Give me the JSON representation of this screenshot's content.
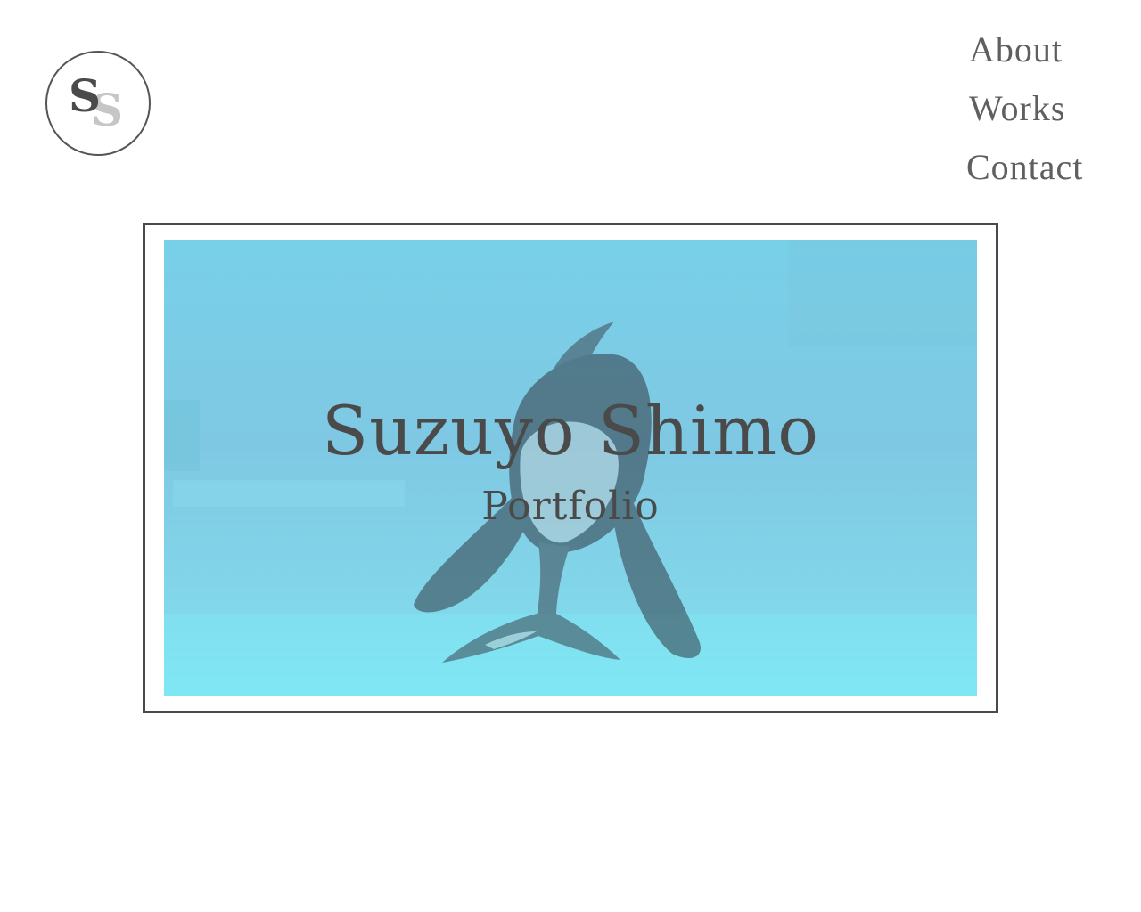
{
  "logo": {
    "letter_primary": "S",
    "letter_secondary": "S"
  },
  "nav": {
    "items": [
      {
        "label": "About"
      },
      {
        "label": "Works"
      },
      {
        "label": "Contact"
      }
    ]
  },
  "hero": {
    "title": "Suzuyo Shimo",
    "subtitle": "Portfolio",
    "image": "orca-underwater-photo"
  },
  "colors": {
    "text": "#4a4a4a",
    "nav_text": "#5f5f5f",
    "logo_secondary": "#c6c6c6",
    "water": "#7fc8e3"
  }
}
